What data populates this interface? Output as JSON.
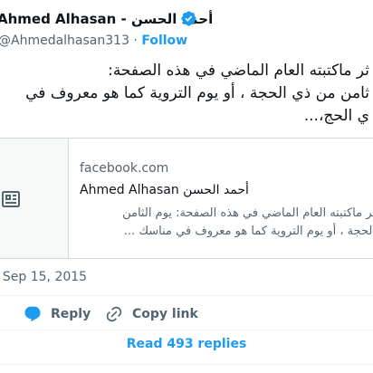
{
  "author": {
    "display_name": "Ahmed Alhasan - أحمد الحسن",
    "handle": "@Ahmedalhasan313",
    "separator": "·",
    "follow_label": "Follow"
  },
  "tweet": {
    "lines": [
      "ثر ماكتبته العام الماضي في هذه الصفحة:",
      "ثامن من ذي الحجة ، أو يوم التروية كما هو معروف في",
      "ي الحج،..."
    ],
    "date": "Sep 15, 2015"
  },
  "card": {
    "domain": "facebook.com",
    "title": "Ahmed Alhasan أحمد الحسن",
    "desc_lines": [
      "ثر ماكتبته العام الماضي في هذه الصفحة: يوم الثامن",
      "الحجة ، أو يوم التروية كما هو معروف في مناسك ..."
    ],
    "icon": "article-icon"
  },
  "actions": {
    "reply_label": "Reply",
    "copy_link_label": "Copy link"
  },
  "read_replies_label": "Read 493 replies",
  "colors": {
    "accent": "#1d9bf0",
    "text": "#0f1419",
    "muted": "#536471",
    "border": "#cfd9de"
  }
}
